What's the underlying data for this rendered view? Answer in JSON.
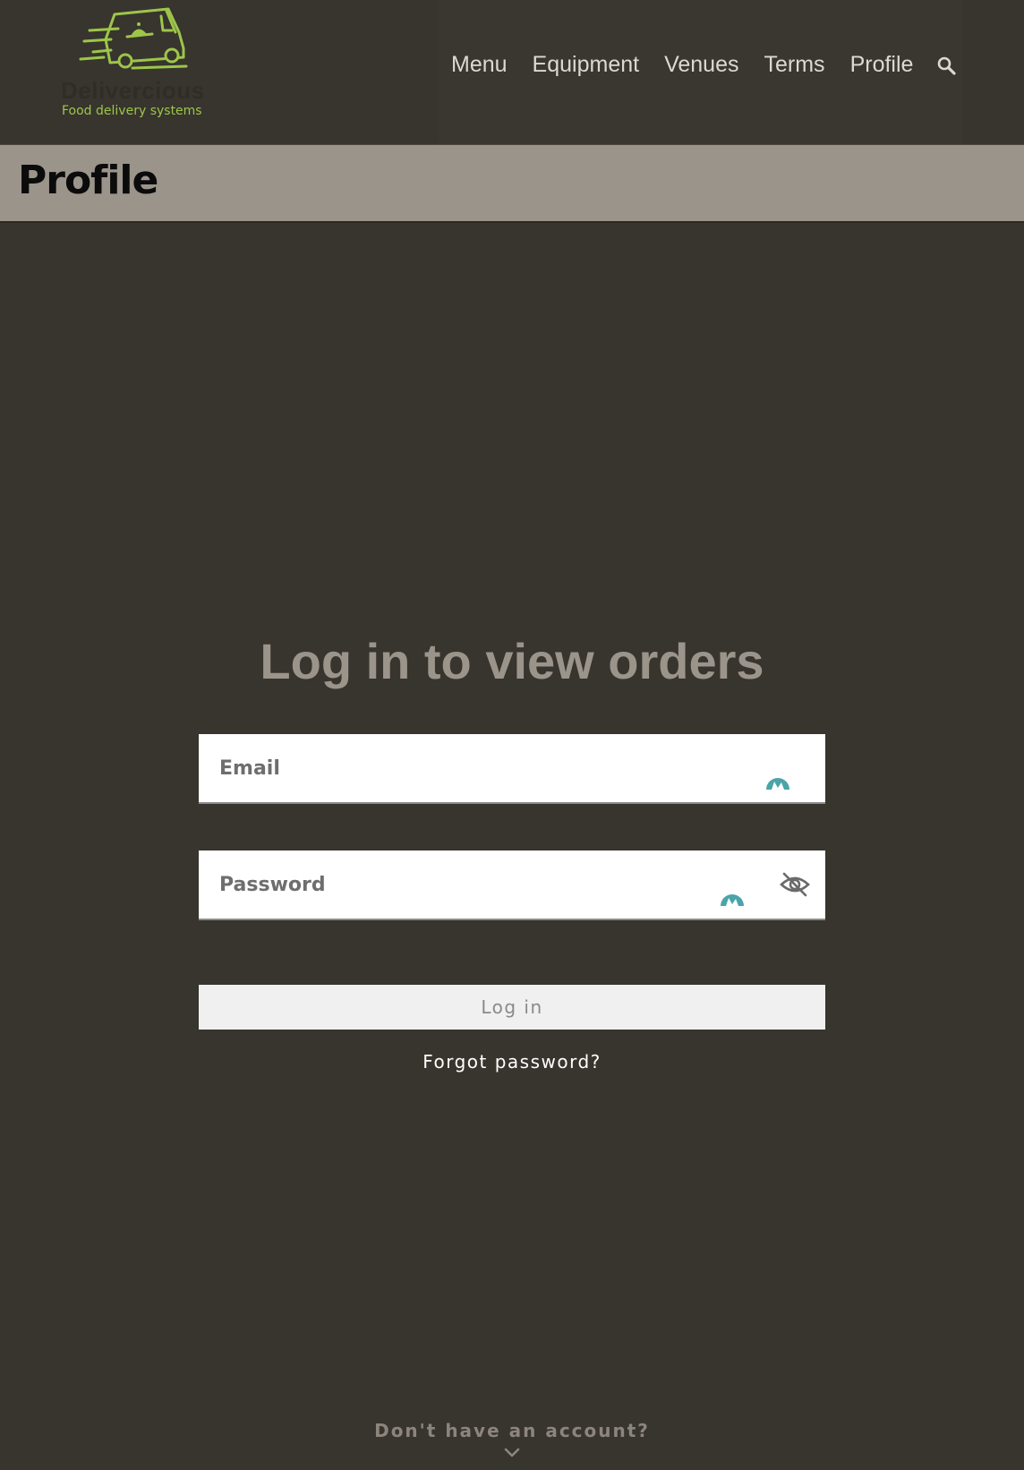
{
  "header": {
    "brand_name": "Delivercious",
    "tagline": "Food delivery systems",
    "nav": [
      {
        "label": "Menu"
      },
      {
        "label": "Equipment"
      },
      {
        "label": "Venues"
      },
      {
        "label": "Terms"
      },
      {
        "label": "Profile"
      }
    ],
    "search_icon": "search-icon"
  },
  "page": {
    "title": "Profile"
  },
  "login": {
    "heading": "Log in to view orders",
    "email_placeholder": "Email",
    "password_placeholder": "Password",
    "submit_label": "Log in",
    "forgot_label": "Forgot password?",
    "signup_prompt": "Don't have an account?",
    "icons": {
      "autofill": "password-manager-icon",
      "toggle_visibility": "eye-slash-icon",
      "expand": "chevron-down-icon"
    }
  },
  "colors": {
    "background": "#38342e",
    "title_bar": "#9b948b",
    "brand_green": "#9cc64a",
    "autofill_teal": "#4aa4a8",
    "heading": "#9b948b"
  }
}
